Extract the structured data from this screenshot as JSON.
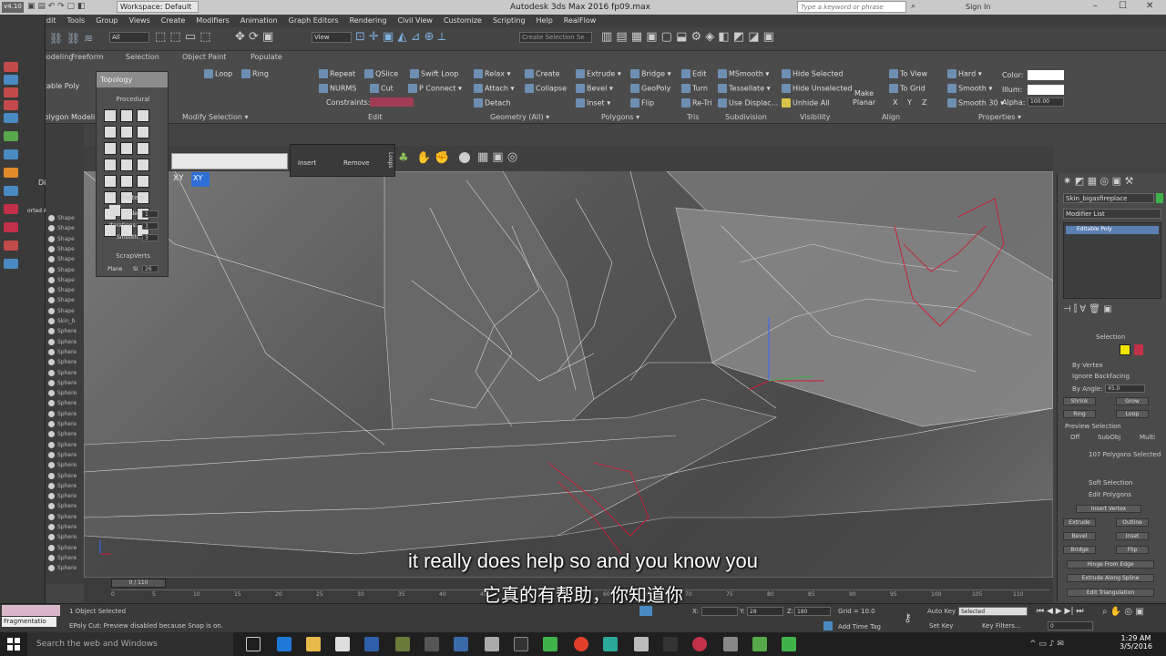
{
  "titlebar": {
    "version": "v4.10",
    "workspace": "Workspace: Default",
    "title": "Autodesk 3ds Max 2016      fp09.max",
    "search_placeholder": "Type a keyword or phrase",
    "sign_in": "Sign In",
    "min": "–",
    "max": "☐",
    "close": "✕"
  },
  "menu": [
    "Edit",
    "Tools",
    "Group",
    "Views",
    "Create",
    "Modifiers",
    "Animation",
    "Graph Editors",
    "Rendering",
    "Civil View",
    "Customize",
    "Scripting",
    "Help",
    "RealFlow"
  ],
  "mainbar": {
    "selection_filter": "All",
    "ref_coord": "View",
    "named_selection": "Create Selection Se"
  },
  "ribbon_tabs": [
    "Modeling",
    "Freeform",
    "Selection",
    "Object Paint",
    "Populate"
  ],
  "ribbon": {
    "left": {
      "editable_poly": "table Poly",
      "polygon_modeling": "Polygon Modeli",
      "modify_selection": "Modify Selection ▾"
    },
    "loop": "Loop",
    "ring": "Ring",
    "edit": {
      "repeat": "Repeat",
      "qslice": "QSlice",
      "swift_loop": "Swift Loop",
      "nurms": "NURMS",
      "cut": "Cut",
      "pconnect": "P Connect ▾",
      "constraints": "Constraints:",
      "label": "Edit"
    },
    "geometry": {
      "relax": "Relax ▾",
      "create": "Create",
      "attach": "Attach ▾",
      "collapse": "Collapse",
      "detach": "Detach",
      "label": "Geometry (All) ▾"
    },
    "polygons": {
      "extrude": "Extrude ▾",
      "bridge": "Bridge ▾",
      "bevel": "Bevel ▾",
      "geopoly": "GeoPoly",
      "inset": "Inset ▾",
      "flip": "Flip",
      "label": "Polygons ▾"
    },
    "tris": {
      "edit": "Edit",
      "turn": "Turn",
      "retri": "Re-Tri",
      "label": "Tris"
    },
    "subdivision": {
      "msmooth": "MSmooth ▾",
      "tessellate": "Tessellate ▾",
      "use_displac": "Use Displac...",
      "label": "Subdivision"
    },
    "visibility": {
      "hide_selected": "Hide Selected",
      "hide_unselected": "Hide Unselected",
      "unhide_all": "Unhide All",
      "label": "Visibility"
    },
    "align": {
      "make_planar": "Make",
      "make_planar2": "Planar",
      "to_view": "To View",
      "to_grid": "To Grid",
      "x": "X",
      "y": "Y",
      "z": "Z",
      "label": "Align"
    },
    "properties": {
      "hard": "Hard ▾",
      "smooth": "Smooth ▾",
      "smooth30": "Smooth 30 ▾",
      "color": "Color:",
      "illum": "Illum:",
      "alpha": "Alpha:",
      "alpha_value": "100.00",
      "label": "Properties ▾"
    }
  },
  "topology": {
    "header": "Topology",
    "procedural": "Procedural",
    "pattern": "Pattern",
    "sides_label": "Sides:",
    "sides": "1",
    "iterations_label": "Iterations:",
    "iterations": "3",
    "smooth_label": "Smooth:",
    "smooth": "3",
    "scrap_verts": "ScrapVerts",
    "plane": "Plane",
    "si_label": "Si",
    "si_value": "26"
  },
  "popup": {
    "insert": "Insert",
    "remove": "Remove",
    "loops": "Loops"
  },
  "axis": {
    "xy": "XY",
    "xy_small": "XY"
  },
  "left": {
    "display": "Display",
    "sorted": "orted Ascen"
  },
  "scene_items": [
    "Shape",
    "Shape",
    "Shape",
    "Shape",
    "Shape",
    "Shape",
    "Shape",
    "Shape",
    "Shape",
    "Shape",
    "Skin_b",
    "Sphere",
    "Sphere",
    "Sphere",
    "Sphere",
    "Sphere",
    "Sphere",
    "Sphere",
    "Sphere",
    "Sphere",
    "Sphere",
    "Sphere",
    "Sphere",
    "Sphere",
    "Sphere",
    "Sphere",
    "Sphere",
    "Sphere",
    "Sphere",
    "Sphere",
    "Sphere",
    "Sphere",
    "Sphere",
    "Sphere",
    "Sphere"
  ],
  "cmd": {
    "object_name": "Skin_bigasfireplace",
    "modifier_list": "Modifier List",
    "stack_item": "Editable Poly",
    "selection": "Selection",
    "by_vertex": "By Vertex",
    "ignore_backfacing": "Ignore Backfacing",
    "by_angle": "By Angle:",
    "angle": "45.0",
    "shrink": "Shrink",
    "grow": "Grow",
    "ring": "Ring",
    "loop": "Loop",
    "preview_selection": "Preview Selection",
    "off": "Off",
    "subobj": "SubObj",
    "multi": "Multi",
    "count": "107 Polygons Selected",
    "soft_selection": "Soft Selection",
    "edit_polygons": "Edit Polygons",
    "insert_vertex": "Insert Vertex",
    "extrude": "Extrude",
    "outline": "Outline",
    "bevel": "Bevel",
    "inset": "Inset",
    "bridge": "Bridge",
    "flip": "Flip",
    "hinge": "Hinge From Edge",
    "extrude_spline": "Extrude Along Spline",
    "edit_triangulation": "Edit Triangulation"
  },
  "timeline": {
    "frame": "0 / 110",
    "ticks": [
      "0",
      "5",
      "10",
      "15",
      "20",
      "25",
      "30",
      "35",
      "40",
      "45",
      "50",
      "55",
      "60",
      "65",
      "70",
      "75",
      "80",
      "85",
      "90",
      "95",
      "100",
      "105",
      "110"
    ]
  },
  "status": {
    "fragmentation": "Fragmentatio",
    "objects_selected": "1 Object Selected",
    "message": "EPoly Cut: Preview disabled because Snap is on.",
    "x_label": "X:",
    "y_label": "Y:",
    "y_value": "28",
    "z_label": "Z:",
    "z_value": "180",
    "grid": "Grid = 10.0",
    "add_time_tag": "Add Time Tag",
    "auto_key": "Auto Key",
    "set_key": "Set Key",
    "selected": "Selected",
    "key_filters": "Key Filters...",
    "frame_value": "0"
  },
  "taskbar": {
    "search": "Search the web and Windows",
    "time": "1:29 AM",
    "date": "3/5/2016"
  },
  "subtitle": {
    "en": "it really does help so and you know you",
    "zh": "它真的有帮助，你知道你"
  },
  "colors": {
    "accent_blue": "#5a7fb3",
    "wire_red": "#d01a35",
    "selected_yellow": "#f2e600"
  }
}
